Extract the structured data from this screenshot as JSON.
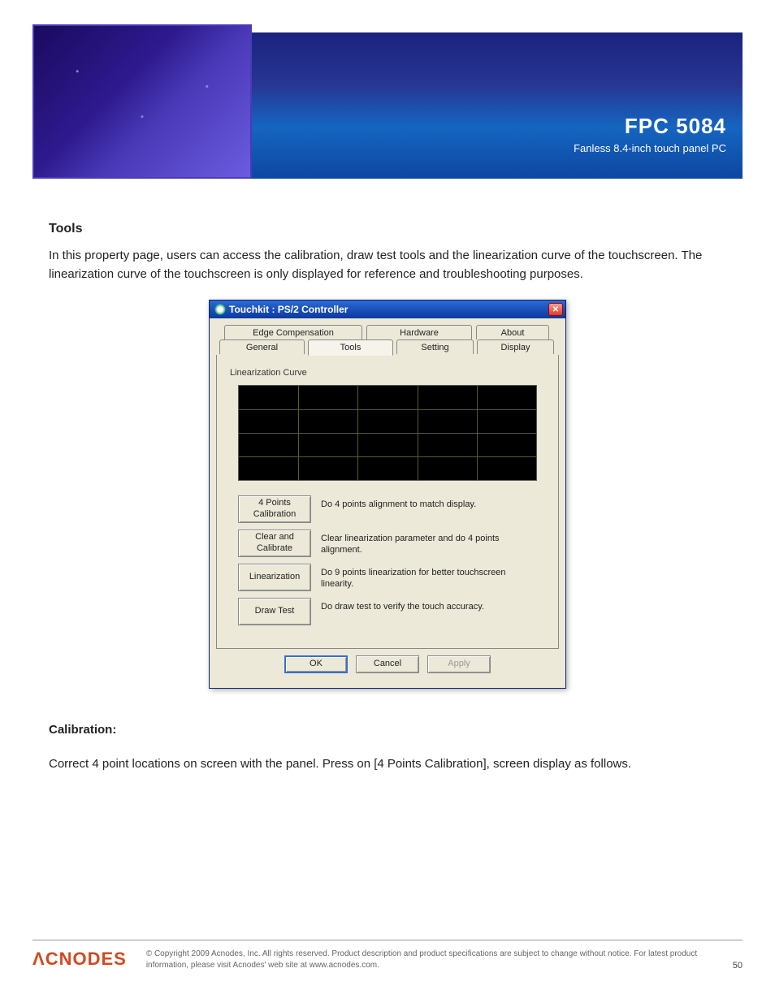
{
  "header": {
    "product": "FPC 5084",
    "subtitle": "Fanless 8.4-inch touch panel PC"
  },
  "body": {
    "heading": "Tools",
    "para1": "In this property page, users can access the calibration, draw test tools and the linearization curve of the touchscreen. The linearization curve of the touchscreen is only displayed for reference and troubleshooting purposes."
  },
  "dialog": {
    "title": "Touchkit : PS/2 Controller",
    "tabs": {
      "edge": "Edge Compensation",
      "hardware": "Hardware",
      "about": "About",
      "general": "General",
      "tools": "Tools",
      "setting": "Setting",
      "display": "Display"
    },
    "group": "Linearization Curve",
    "rows": [
      {
        "btn": "4 Points Calibration",
        "desc": "Do 4 points alignment to match display."
      },
      {
        "btn": "Clear and Calibrate",
        "desc": "Clear linearization parameter and do 4 points alignment."
      },
      {
        "btn": "Linearization",
        "desc": "Do 9 points linearization for better touchscreen linearity."
      },
      {
        "btn": "Draw Test",
        "desc": "Do draw test to verify the touch accuracy."
      }
    ],
    "buttons": {
      "ok": "OK",
      "cancel": "Cancel",
      "apply": "Apply"
    }
  },
  "post": {
    "para2": "Calibration:",
    "para3": "Correct 4 point locations on screen with the panel. Press on [4 Points Calibration], screen display as follows."
  },
  "footer": {
    "logo": "ACNODES",
    "copy": "© Copyright 2009 Acnodes, Inc. All rights reserved. Product description and product specifications are subject to change without notice. For latest product information, please visit Acnodes' web site at www.acnodes.com.",
    "page": "50"
  }
}
